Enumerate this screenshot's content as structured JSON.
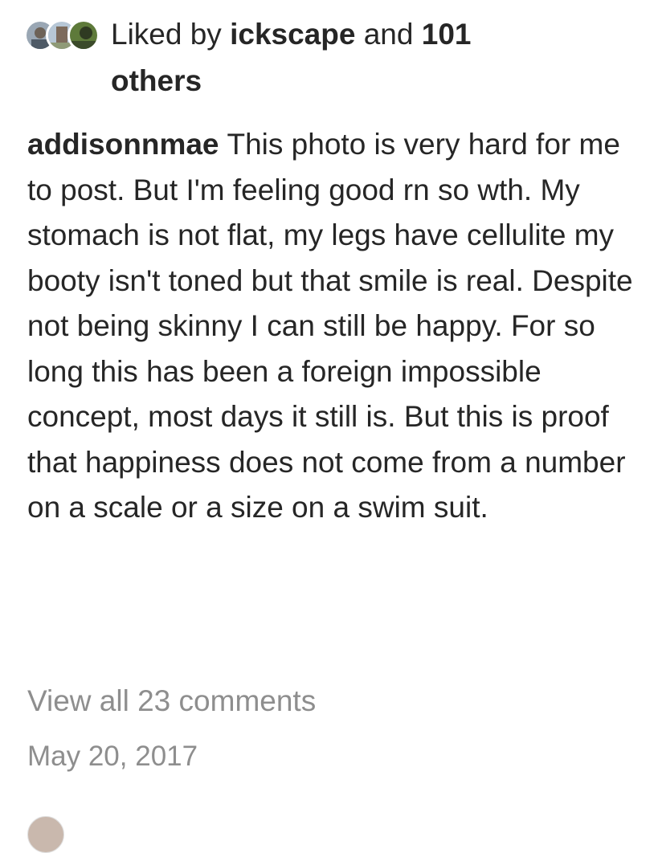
{
  "likes": {
    "prefix": "Liked by ",
    "user": "ickscape",
    "conjunction": " and ",
    "count": "101",
    "suffix": "others",
    "avatars": [
      "liker-avatar",
      "liker-avatar",
      "liker-avatar"
    ]
  },
  "post": {
    "username": "addisonnmae",
    "caption": "This photo is very hard for me to post. But I'm feeling good rn so wth. My stomach is not flat, my legs have cellulite my booty isn't toned but that smile is real. Despite not being skinny I can still be happy. For so long this has been a foreign impossible concept, most days it still is. But this is proof that happiness does not come from a number on a scale or a size on a swim suit.",
    "view_comments": "View all 23 comments",
    "date": "May 20, 2017"
  },
  "colors": {
    "text": "#262626",
    "muted": "#8e8e8e",
    "background": "#ffffff"
  }
}
